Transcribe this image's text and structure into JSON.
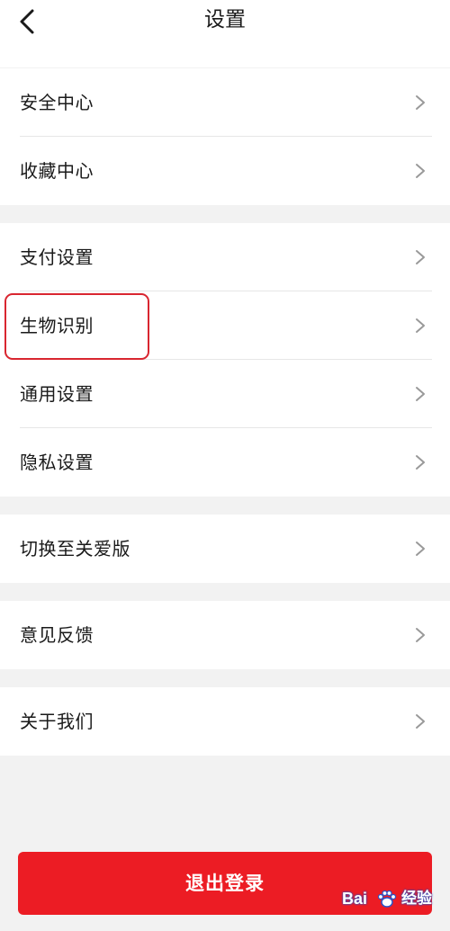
{
  "header": {
    "title": "设置"
  },
  "groups": [
    {
      "items": [
        {
          "label": "安全中心"
        },
        {
          "label": "收藏中心"
        }
      ]
    },
    {
      "items": [
        {
          "label": "支付设置"
        },
        {
          "label": "生物识别"
        },
        {
          "label": "通用设置"
        },
        {
          "label": "隐私设置"
        }
      ]
    },
    {
      "items": [
        {
          "label": "切换至关爱版"
        }
      ]
    },
    {
      "items": [
        {
          "label": "意见反馈"
        }
      ]
    },
    {
      "items": [
        {
          "label": "关于我们"
        }
      ]
    }
  ],
  "logout": {
    "label": "退出登录"
  },
  "watermark": {
    "brand": "Bai",
    "suffix": "经验"
  },
  "colors": {
    "accent": "#ec1c24",
    "highlight": "#d92630",
    "background": "#f2f2f2"
  },
  "icons": {
    "back": "chevron-left-icon",
    "row_arrow": "chevron-right-icon"
  }
}
